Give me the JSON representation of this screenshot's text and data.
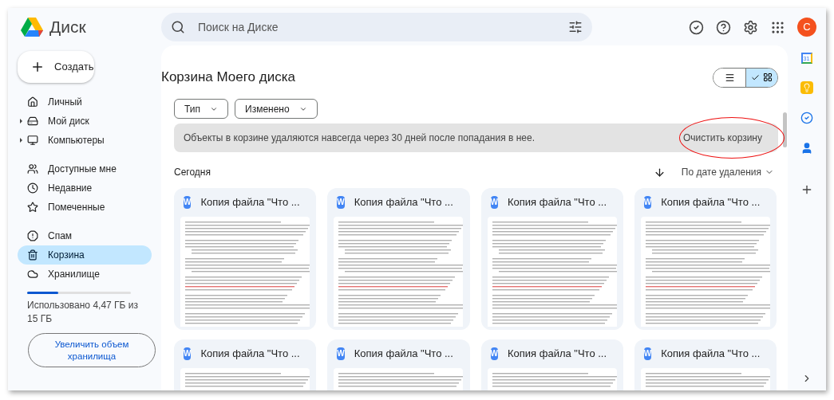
{
  "app": {
    "name": "Диск"
  },
  "search": {
    "placeholder": "Поиск на Диске"
  },
  "account": {
    "initial": "C"
  },
  "create_button": {
    "label": "Создать"
  },
  "sidebar": {
    "sections": [
      [
        {
          "label": "Личный",
          "kind": "home",
          "has_children": false,
          "selected": false
        },
        {
          "label": "Мой диск",
          "kind": "drive",
          "has_children": true,
          "selected": false
        },
        {
          "label": "Компьютеры",
          "kind": "computer",
          "has_children": true,
          "selected": false
        }
      ],
      [
        {
          "label": "Доступные мне",
          "kind": "people",
          "has_children": false,
          "selected": false
        },
        {
          "label": "Недавние",
          "kind": "recent",
          "has_children": false,
          "selected": false
        },
        {
          "label": "Помеченные",
          "kind": "starred",
          "has_children": false,
          "selected": false
        }
      ],
      [
        {
          "label": "Спам",
          "kind": "spam",
          "has_children": false,
          "selected": false
        },
        {
          "label": "Корзина",
          "kind": "trash",
          "has_children": false,
          "selected": true
        },
        {
          "label": "Хранилище",
          "kind": "storage",
          "has_children": false,
          "selected": false
        }
      ]
    ]
  },
  "storage": {
    "level": 0.3,
    "text": "Использовано 4,47 ГБ из 15 ГБ",
    "upgrade_button": "Увеличить объем хранилища"
  },
  "page_title": "Корзина Моего диска",
  "view_toggle": [
    {
      "kind": "list",
      "selected": false
    },
    {
      "kind": "grid",
      "selected": true
    }
  ],
  "filters": [
    "Тип",
    "Изменено"
  ],
  "notice": {
    "text": "Объекты в корзине удаляются навсегда через 30 дней после попадания в нее.",
    "action": "Очистить корзину",
    "highlighted": true
  },
  "section_title": "Сегодня",
  "sort": {
    "label": "По дате удаления"
  },
  "files": [
    {
      "name": "Копия файла \"Что ...",
      "icon_letter": "W"
    },
    {
      "name": "Копия файла \"Что ...",
      "icon_letter": "W"
    },
    {
      "name": "Копия файла \"Что ...",
      "icon_letter": "W"
    },
    {
      "name": "Копия файла \"Что ...",
      "icon_letter": "W"
    },
    {
      "name": "Копия файла \"Что ...",
      "icon_letter": "W"
    },
    {
      "name": "Копия файла \"Что ...",
      "icon_letter": "W"
    },
    {
      "name": "Копия файла \"Что ...",
      "icon_letter": "W"
    },
    {
      "name": "Копия файла \"Что ...",
      "icon_letter": "W"
    }
  ],
  "side_panel": {
    "calendar_day": "31"
  }
}
